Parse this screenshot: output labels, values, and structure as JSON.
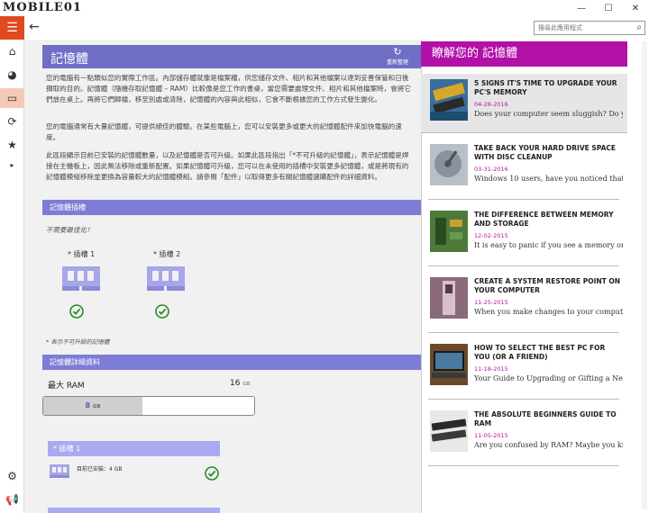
{
  "app": {
    "logo": "MOBILE01",
    "window_controls": [
      "—",
      "☐",
      "✕"
    ]
  },
  "search": {
    "placeholder": "搜尋此應用程式"
  },
  "colors": {
    "accent_nav": "#e04a1f",
    "main_header": "#6f6fc6",
    "section_bar": "#7d7dd8",
    "side_header": "#b310a8"
  },
  "rail": {
    "icons": [
      "home-icon",
      "dashboard-icon",
      "memory-icon",
      "optimize-icon",
      "star-icon"
    ],
    "bottom_icons": [
      "settings-icon",
      "feedback-icon"
    ]
  },
  "main": {
    "title": "記憶體",
    "refresh_label": "重新整理",
    "paragraphs": [
      "您的電腦有一點類似您的實際工作區。內部儲存體就像是檔案櫃，供您儲存文件、相片和其他檔案以達到妥善保管和日後擷取的目的。記憶體（隨機存取記憶體 – RAM）比較像是您工作的書桌，當您需要處理文件、相片和其他檔案時，會將它們放在桌上。再將它們歸檔，移至別處或清除，記憶體的內容與此相似，它會不斷根據您的工作方式發生變化。",
      "您的電腦通常有大量記憶體，可提供絕佳的體驗。在某些電腦上，您可以安裝更多或更大的記憶體配件來加快電腦的速度。",
      "此區段顯示目前已安裝的記憶體數量，以及記憶體是否可升級。如果此區段指出「*不可升級的記憶體」，表示記憶體是焊接在主機板上，因此無法移除或重新配置。如果記憶體可升級，您可以在未使用的插槽中安裝更多記憶體，或是將現有的記憶體模組移除並更換為容量較大的記憶體模組。請參閱「配件」以取得更多有關記憶體選購配件的詳細資料。"
    ],
    "slots_section": {
      "title": "記憶體插槽",
      "status": "不需要最佳化！",
      "slots": [
        {
          "label": "* 插槽 1"
        },
        {
          "label": "* 插槽 2"
        }
      ],
      "footnote": "* 表示不可升級的記憶體"
    },
    "details_section": {
      "title": "記憶體詳細資料",
      "max_label": "最大 RAM",
      "max_value": "16",
      "unit": "GB",
      "installed_value": "8",
      "installed_fraction": 0.5,
      "slot_card": {
        "title": "* 插槽 1",
        "installed_text": "目前已安裝：4 GB"
      }
    }
  },
  "side": {
    "title": "瞭解您的 記憶體",
    "articles": [
      {
        "title": "5 Signs It's Time to Upgrade Your PC's Memory",
        "date": "04-28-2016",
        "desc": "Does your computer seem sluggish? Do yo..."
      },
      {
        "title": "Take Back Your Hard Drive Space with Disc Cleanup",
        "date": "03-31-2016",
        "desc": "Windows 10 users, have you noticed that a..."
      },
      {
        "title": "The Difference Between Memory and Storage",
        "date": "12-02-2015",
        "desc": "It is easy to panic if you see a memory or..."
      },
      {
        "title": "Create a System Restore Point on Your Computer",
        "date": "11-25-2015",
        "desc": "When you make changes to your computer..."
      },
      {
        "title": "How to Select the Best PC for You (or a Friend)",
        "date": "11-18-2015",
        "desc": "Your Guide to Upgrading or Gifting a New..."
      },
      {
        "title": "The Absolute Beginners Guide to RAM",
        "date": "11-05-2015",
        "desc": "Are you confused by RAM? Maybe you kno..."
      }
    ]
  }
}
